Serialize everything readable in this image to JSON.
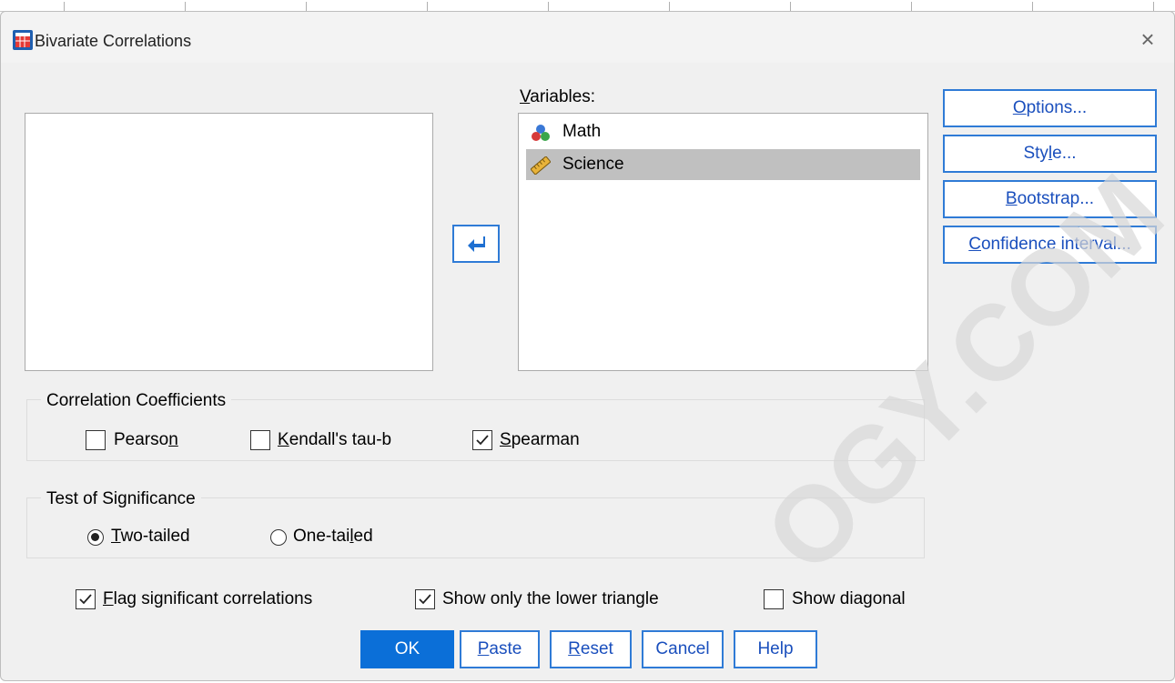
{
  "dialog": {
    "title": "Bivariate Correlations"
  },
  "variables": {
    "label_prefix": "",
    "label_mnemonic": "V",
    "label_rest": "ariables:",
    "items": [
      {
        "name": "Math",
        "icon": "nominal-icon",
        "selected": false
      },
      {
        "name": "Science",
        "icon": "scale-icon",
        "selected": true
      }
    ]
  },
  "side_buttons": {
    "options": {
      "pre": "",
      "mn": "O",
      "post": "ptions..."
    },
    "style": {
      "pre": "Sty",
      "mn": "l",
      "post": "e..."
    },
    "bootstrap": {
      "pre": "",
      "mn": "B",
      "post": "ootstrap..."
    },
    "confidence": {
      "pre": "",
      "mn": "C",
      "post": "onfidence interval..."
    }
  },
  "correlation": {
    "title": "Correlation Coefficients",
    "pearson": {
      "pre": "Pearso",
      "mn": "n",
      "post": "",
      "checked": false
    },
    "kendall": {
      "pre": "",
      "mn": "K",
      "post": "endall's tau-b",
      "checked": false
    },
    "spearman": {
      "pre": "",
      "mn": "S",
      "post": "pearman",
      "checked": true
    }
  },
  "significance": {
    "title": "Test of Significance",
    "two": {
      "pre": "",
      "mn": "T",
      "post": "wo-tailed",
      "selected": true
    },
    "one": {
      "pre": "One-tai",
      "mn": "l",
      "post": "ed",
      "selected": false
    }
  },
  "options_row": {
    "flag": {
      "pre": "",
      "mn": "F",
      "post": "lag significant correlations",
      "checked": true
    },
    "lower": {
      "pre": "Show only the lower trian",
      "mn": "g",
      "post": "le",
      "checked": true
    },
    "diagonal": {
      "pre": "Show diagonal",
      "mn": "",
      "post": "",
      "checked": false
    }
  },
  "bottom_buttons": {
    "ok": {
      "pre": "OK",
      "mn": "",
      "post": ""
    },
    "paste": {
      "pre": "",
      "mn": "P",
      "post": "aste"
    },
    "reset": {
      "pre": "",
      "mn": "R",
      "post": "eset"
    },
    "cancel": {
      "pre": "Cancel",
      "mn": "",
      "post": ""
    },
    "help": {
      "pre": "Help",
      "mn": "",
      "post": ""
    }
  },
  "watermark": "OGY.COM",
  "colors": {
    "accent": "#2f7bd6",
    "link_text": "#1a4fbd",
    "ok_fill": "#0b6fd8",
    "selection": "#c0c0c0"
  }
}
